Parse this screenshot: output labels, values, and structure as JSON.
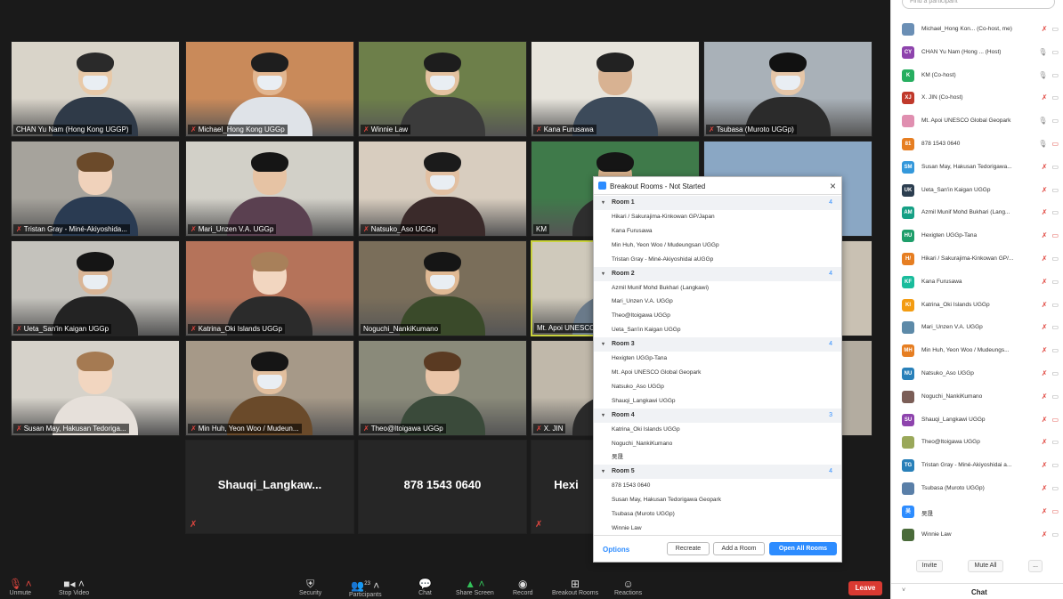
{
  "tiles": [
    {
      "name": "CHAN Yu Nam (Hong Kong UGGP)",
      "muted": false
    },
    {
      "name": "Michael_Hong Kong UGGp",
      "muted": true
    },
    {
      "name": "Winnie Law",
      "muted": true
    },
    {
      "name": "Kana Furusawa",
      "muted": true
    },
    {
      "name": "Tsubasa (Muroto UGGp)",
      "muted": true
    },
    {
      "name": "Tristan Gray - Miné-Akiyoshida...",
      "muted": true
    },
    {
      "name": "Mari_Unzen V.A. UGGp",
      "muted": true
    },
    {
      "name": "Natsuko_Aso UGGp",
      "muted": true
    },
    {
      "name": "KM",
      "muted": false
    },
    {
      "name": "",
      "muted": false
    },
    {
      "name": "Ueta_San'in Kaigan UGGp",
      "muted": true
    },
    {
      "name": "Katrina_Oki Islands UGGp",
      "muted": true
    },
    {
      "name": "Noguchi_NankiKumano",
      "muted": false
    },
    {
      "name": "Mt. Apoi UNESCO",
      "muted": false
    },
    {
      "name": "",
      "muted": false
    },
    {
      "name": "Susan May, Hakusan Tedoriga...",
      "muted": true
    },
    {
      "name": "Min Huh, Yeon Woo / Mudeun...",
      "muted": true
    },
    {
      "name": "Theo@Itoigawa UGGp",
      "muted": true
    },
    {
      "name": "X. JIN",
      "muted": true
    },
    {
      "name": "",
      "muted": false
    }
  ],
  "blank_tiles": [
    {
      "name": "Shauqi_Langkaw...",
      "muted": true
    },
    {
      "name": "878 1543 0640",
      "muted": false
    },
    {
      "name": "Hexi",
      "muted": true
    }
  ],
  "toolbar": {
    "unmute": "Unmute",
    "video": "Stop Video",
    "security": "Security",
    "participants": "Participants",
    "participants_count": "23",
    "chat": "Chat",
    "share": "Share Screen",
    "record": "Record",
    "breakout": "Breakout Rooms",
    "reactions": "Reactions",
    "leave": "Leave"
  },
  "breakout": {
    "title": "Breakout Rooms - Not Started",
    "rooms": [
      {
        "name": "Room 1",
        "count": "4",
        "members": [
          "Hikari / Sakurajima-Kinkowan GP/Japan",
          "Kana Furusawa",
          "Min Huh, Yeon Woo / Mudeungsan UGGp",
          "Tristan Gray - Miné-Akiyoshidai aUGGp"
        ]
      },
      {
        "name": "Room 2",
        "count": "4",
        "members": [
          "Azmil Munif Mohd Bukhari (Langkawi)",
          "Mari_Unzen V.A. UGGp",
          "Theo@Itoigawa UGGp",
          "Ueta_San'in Kaigan UGGp"
        ]
      },
      {
        "name": "Room 3",
        "count": "4",
        "members": [
          "Hexigten UGGp-Tana",
          "Mt. Apoi UNESCO Global Geopark",
          "Natsuko_Aso UGGp",
          "Shauqi_Langkawi UGGp"
        ]
      },
      {
        "name": "Room 4",
        "count": "3",
        "members": [
          "Katrina_Oki Islands UGGp",
          "Noguchi_NankiKumano",
          "吴晟"
        ]
      },
      {
        "name": "Room 5",
        "count": "4",
        "members": [
          "878 1543 0640",
          "Susan May, Hakusan Tedorigawa Geopark",
          "Tsubasa (Muroto UGGp)",
          "Winnie Law"
        ]
      }
    ],
    "options": "Options",
    "recreate": "Recreate",
    "add_room": "Add a Room",
    "open_all": "Open All Rooms"
  },
  "panel": {
    "search_placeholder": "Find a participant",
    "participants": [
      {
        "initials": "",
        "color": "#6b8fb5",
        "name": "Michael_Hong Kon... (Co-host, me)",
        "mic": "off",
        "cam": "on"
      },
      {
        "initials": "CY",
        "color": "#8e44ad",
        "name": "CHAN Yu Nam (Hong ... (Host)",
        "mic": "on",
        "cam": "on"
      },
      {
        "initials": "K",
        "color": "#27ae60",
        "name": "KM (Co-host)",
        "mic": "on",
        "cam": "on"
      },
      {
        "initials": "XJ",
        "color": "#c0392b",
        "name": "X. JIN (Co-host)",
        "mic": "off",
        "cam": "on"
      },
      {
        "initials": "",
        "color": "#e08fb0",
        "name": "Mt. Apoi UNESCO Global Geopark",
        "mic": "on",
        "cam": "on"
      },
      {
        "initials": "81",
        "color": "#e67e22",
        "name": "878 1543 0640",
        "mic": "on",
        "cam": "off"
      },
      {
        "initials": "SM",
        "color": "#3498db",
        "name": "Susan May, Hakusan Tedorigawa...",
        "mic": "off",
        "cam": "on"
      },
      {
        "initials": "UK",
        "color": "#2c3e50",
        "name": "Ueta_San'in Kaigan UGGp",
        "mic": "off",
        "cam": "on"
      },
      {
        "initials": "AM",
        "color": "#16a085",
        "name": "Azmil Munif Mohd Bukhari (Lang...",
        "mic": "off",
        "cam": "on"
      },
      {
        "initials": "HU",
        "color": "#1e9e6a",
        "name": "Hexigten UGGp-Tana",
        "mic": "off",
        "cam": "off"
      },
      {
        "initials": "H/",
        "color": "#e67e22",
        "name": "Hikari / Sakurajima-Kinkowan GP/...",
        "mic": "off",
        "cam": "on"
      },
      {
        "initials": "KF",
        "color": "#1abc9c",
        "name": "Kana Furusawa",
        "mic": "off",
        "cam": "on"
      },
      {
        "initials": "KI",
        "color": "#f39c12",
        "name": "Katrina_Oki Islands UGGp",
        "mic": "off",
        "cam": "on"
      },
      {
        "initials": "",
        "color": "#5d8aa8",
        "name": "Mari_Unzen V.A. UGGp",
        "mic": "off",
        "cam": "on"
      },
      {
        "initials": "MH",
        "color": "#e67e22",
        "name": "Min Huh, Yeon Woo / Mudeungs...",
        "mic": "off",
        "cam": "on"
      },
      {
        "initials": "NU",
        "color": "#2980b9",
        "name": "Natsuko_Aso UGGp",
        "mic": "off",
        "cam": "on"
      },
      {
        "initials": "",
        "color": "#7b5e57",
        "name": "Noguchi_NankiKumano",
        "mic": "off",
        "cam": "on"
      },
      {
        "initials": "SU",
        "color": "#8e44ad",
        "name": "Shauqi_Langkawi UGGp",
        "mic": "off",
        "cam": "off"
      },
      {
        "initials": "",
        "color": "#9aa85a",
        "name": "Theo@Itoigawa UGGp",
        "mic": "off",
        "cam": "on"
      },
      {
        "initials": "TG",
        "color": "#2980b9",
        "name": "Tristan Gray - Miné-Akiyoshidai a...",
        "mic": "off",
        "cam": "on"
      },
      {
        "initials": "",
        "color": "#5a7fa8",
        "name": "Tsubasa (Muroto UGGp)",
        "mic": "off",
        "cam": "on"
      },
      {
        "initials": "吴",
        "color": "#2d8cff",
        "name": "吴晟",
        "mic": "off",
        "cam": "off"
      },
      {
        "initials": "",
        "color": "#4a6b3a",
        "name": "Winnie Law",
        "mic": "off",
        "cam": "on"
      }
    ],
    "invite": "Invite",
    "mute_all": "Mute All",
    "more": "...",
    "chat": "Chat"
  },
  "colors": {
    "accent": "#2d8cff",
    "muted_red": "#e0463f",
    "leave_red": "#d93a32"
  }
}
